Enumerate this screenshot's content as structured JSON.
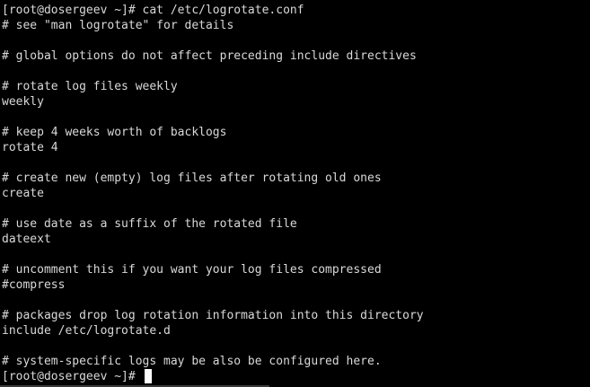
{
  "terminal": {
    "lines": [
      {
        "text": "[root@dosergeev ~]# cat /etc/logrotate.conf"
      },
      {
        "text": "# see \"man logrotate\" for details"
      },
      {
        "text": ""
      },
      {
        "text": "# global options do not affect preceding include directives"
      },
      {
        "text": ""
      },
      {
        "text": "# rotate log files weekly"
      },
      {
        "text": "weekly"
      },
      {
        "text": ""
      },
      {
        "text": "# keep 4 weeks worth of backlogs"
      },
      {
        "text": "rotate 4"
      },
      {
        "text": ""
      },
      {
        "text": "# create new (empty) log files after rotating old ones"
      },
      {
        "text": "create"
      },
      {
        "text": ""
      },
      {
        "text": "# use date as a suffix of the rotated file"
      },
      {
        "text": "dateext"
      },
      {
        "text": ""
      },
      {
        "text": "# uncomment this if you want your log files compressed"
      },
      {
        "text": "#compress"
      },
      {
        "text": ""
      },
      {
        "text": "# packages drop log rotation information into this directory"
      },
      {
        "text": "include /etc/logrotate.d"
      },
      {
        "text": ""
      },
      {
        "text": "# system-specific logs may be also be configured here."
      },
      {
        "text": "[root@dosergeev ~]# "
      }
    ],
    "colors": {
      "background": "#000000",
      "foreground": "#d9d9d9",
      "cursor": "#ffffff"
    }
  }
}
